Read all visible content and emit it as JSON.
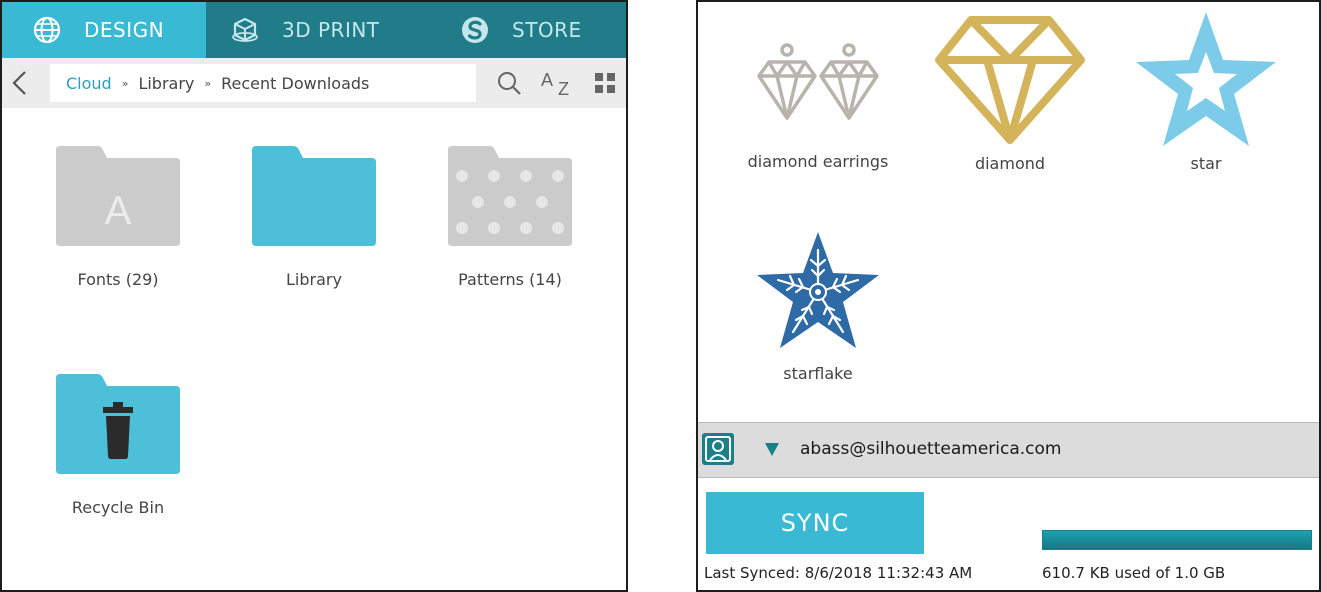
{
  "left": {
    "tabs": [
      {
        "label": "DESIGN",
        "icon": "globe-icon",
        "active": true
      },
      {
        "label": "3D PRINT",
        "icon": "cube-icon",
        "active": false
      },
      {
        "label": "STORE",
        "icon": "silhouette-s-icon",
        "active": false
      }
    ],
    "nav": {
      "back_icon": "chevron-left-icon",
      "breadcrumb": [
        "Cloud",
        "Library",
        "Recent Downloads"
      ],
      "search_icon": "search-icon",
      "sort_label": "AZ",
      "grid_icon": "grid-view-icon"
    },
    "folders": [
      {
        "label": "Fonts (29)",
        "icon": "fonts-folder-icon",
        "letter": "A"
      },
      {
        "label": "Library",
        "icon": "library-folder-icon"
      },
      {
        "label": "Patterns (14)",
        "icon": "patterns-folder-icon"
      },
      {
        "label": "Recycle Bin",
        "icon": "recycle-bin-folder-icon"
      }
    ]
  },
  "right": {
    "designs": [
      {
        "label": "diamond earrings",
        "icon": "diamond-earrings-thumb"
      },
      {
        "label": "diamond",
        "icon": "diamond-thumb"
      },
      {
        "label": "star",
        "icon": "star-thumb"
      },
      {
        "label": "starflake",
        "icon": "starflake-thumb"
      }
    ],
    "account": {
      "email": "abass@silhouetteamerica.com",
      "avatar_icon": "user-avatar-icon",
      "dropdown_icon": "caret-down-icon"
    },
    "sync": {
      "button_label": "SYNC",
      "last_synced": "Last Synced: 8/6/2018 11:32:43 AM",
      "storage_text": "610.7 KB used of 1.0 GB",
      "storage_fraction": 1.0
    }
  },
  "colors": {
    "teal_dark": "#1f7c88",
    "teal_light": "#3ab9d4",
    "folder_gray": "#cbcbcb",
    "folder_blue": "#4dbfd9",
    "gold": "#d4b45b",
    "silver": "#b8b3ad",
    "star_blue": "#7ccbe8",
    "starflake_blue": "#2e6aa5"
  }
}
